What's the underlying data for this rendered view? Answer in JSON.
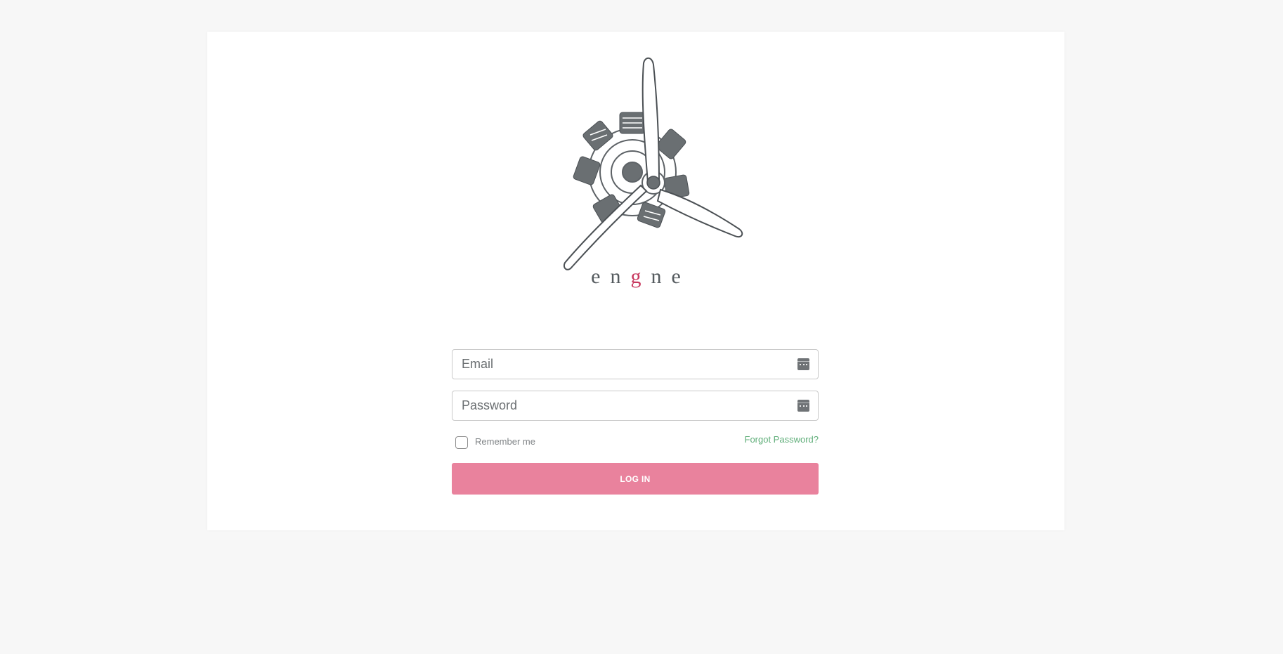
{
  "brand": {
    "logo_icon": "radial-engine-propeller-icon",
    "wordmark_parts": [
      "e",
      "n",
      "g",
      "n",
      "e"
    ],
    "accent_color": "#c8395f",
    "text_color": "#555b5f"
  },
  "login": {
    "email": {
      "placeholder": "Email",
      "value": "",
      "icon": "password-manager-key-icon"
    },
    "password": {
      "placeholder": "Password",
      "value": "",
      "icon": "password-manager-key-icon"
    },
    "remember_label": "Remember me",
    "remember_checked": false,
    "forgot_label": "Forgot Password?",
    "submit_label": "LOG IN",
    "button_color": "#e9829d",
    "link_color": "#5fae79"
  }
}
